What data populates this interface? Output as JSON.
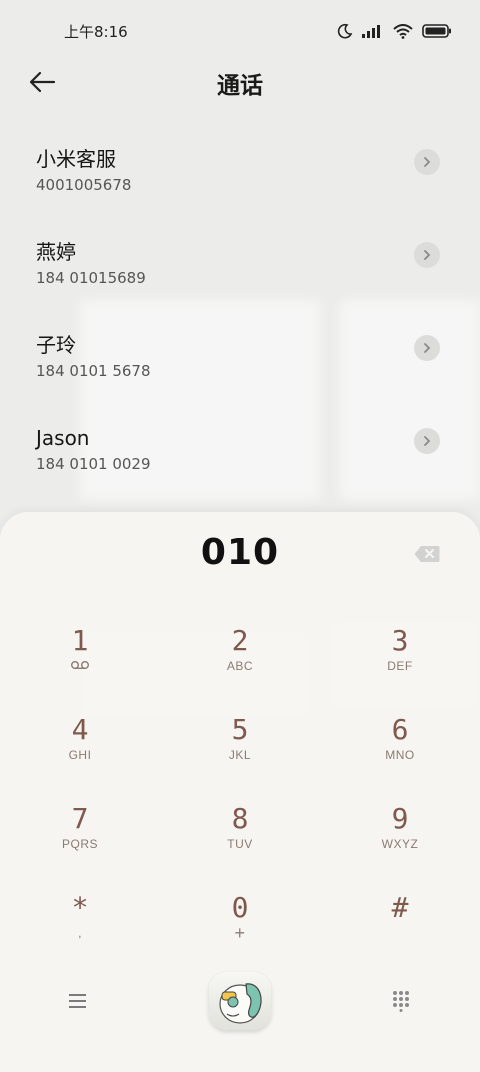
{
  "status_bar": {
    "time": "上午8:16",
    "icons": [
      "moon-icon",
      "signal-icon",
      "wifi-icon",
      "battery-icon"
    ]
  },
  "header": {
    "back_icon": "back-arrow-icon",
    "title": "通话"
  },
  "contacts": [
    {
      "name": "小米客服",
      "number": "4001005678"
    },
    {
      "name": "燕婷",
      "number": "184 01015689"
    },
    {
      "name": "子玲",
      "number": "184 0101 5678"
    },
    {
      "name": "Jason",
      "number": "184 0101 0029"
    }
  ],
  "dialer": {
    "input": "010",
    "keys": [
      {
        "digit": "1",
        "letters": "voicemail-icon"
      },
      {
        "digit": "2",
        "letters": "ABC"
      },
      {
        "digit": "3",
        "letters": "DEF"
      },
      {
        "digit": "4",
        "letters": "GHI"
      },
      {
        "digit": "5",
        "letters": "JKL"
      },
      {
        "digit": "6",
        "letters": "MNO"
      },
      {
        "digit": "7",
        "letters": "PQRS"
      },
      {
        "digit": "8",
        "letters": "TUV"
      },
      {
        "digit": "9",
        "letters": "WXYZ"
      },
      {
        "digit": "*",
        "letters": ","
      },
      {
        "digit": "0",
        "letters": "+"
      },
      {
        "digit": "#",
        "letters": ""
      }
    ]
  },
  "colors": {
    "accent_digit": "#7f5a4c",
    "background": "#ececea",
    "panel": "#f6f5f2"
  }
}
